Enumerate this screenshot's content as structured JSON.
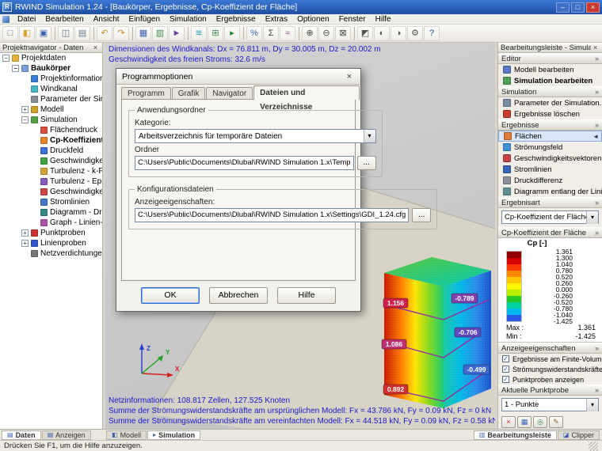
{
  "titlebar": {
    "title": "RWIND Simulation 1.24 - [Baukörper, Ergebnisse, Cp-Koeffizient der Fläche]",
    "minimize": "–",
    "maximize": "□",
    "close": "×"
  },
  "menubar": {
    "items": [
      "Datei",
      "Bearbeiten",
      "Ansicht",
      "Einfügen",
      "Simulation",
      "Ergebnisse",
      "Extras",
      "Optionen",
      "Fenster",
      "Hilfe"
    ]
  },
  "toolbar": {
    "icons": [
      {
        "name": "new-project",
        "glyph": "□",
        "color": "#5a6b7d"
      },
      {
        "name": "open-project",
        "glyph": "◧",
        "color": "#d9a43a"
      },
      {
        "name": "save-project",
        "glyph": "▣",
        "color": "#3a62b0"
      },
      {
        "name": "print",
        "glyph": "◫",
        "color": "#5a6b7d"
      },
      {
        "name": "copy-view",
        "glyph": "▤",
        "color": "#6a7b8d"
      },
      {
        "name": "undo",
        "glyph": "↶",
        "color": "#c09020"
      },
      {
        "name": "redo",
        "glyph": "↷",
        "color": "#c09020"
      },
      {
        "name": "table-view",
        "glyph": "▦",
        "color": "#3a62b0"
      },
      {
        "name": "grid-view",
        "glyph": "▥",
        "color": "#3a8a50"
      },
      {
        "name": "animation",
        "glyph": "►",
        "color": "#7040a0"
      },
      {
        "name": "wind-flow",
        "glyph": "≋",
        "color": "#2a9ab0"
      },
      {
        "name": "mesh",
        "glyph": "⊞",
        "color": "#3a8a50"
      },
      {
        "name": "start-simulation",
        "glyph": "▸",
        "color": "#208030"
      },
      {
        "name": "percent-scale",
        "glyph": "%",
        "color": "#3a62b0"
      },
      {
        "name": "sum-forces",
        "glyph": "Σ",
        "color": "#444444"
      },
      {
        "name": "chart-view",
        "glyph": "≈",
        "color": "#884488"
      },
      {
        "name": "zoom-in",
        "glyph": "⊕",
        "color": "#444444"
      },
      {
        "name": "zoom-out",
        "glyph": "⊖",
        "color": "#444444"
      },
      {
        "name": "zoom-window",
        "glyph": "⊠",
        "color": "#444444"
      },
      {
        "name": "view-iso",
        "glyph": "◩",
        "color": "#555555"
      },
      {
        "name": "view-x",
        "glyph": "◐",
        "color": "#555555"
      },
      {
        "name": "view-z",
        "glyph": "◑",
        "color": "#555555"
      },
      {
        "name": "settings",
        "glyph": "⚙",
        "color": "#555555"
      },
      {
        "name": "help",
        "glyph": "?",
        "color": "#205090"
      }
    ]
  },
  "navigator": {
    "title": "Projektnavigator - Daten",
    "close_icon": "×",
    "tree": [
      {
        "label": "Projektdaten",
        "exp": "−",
        "color": "#e8b33a"
      },
      {
        "label": "Baukörper",
        "exp": "−",
        "color": "#7aa0d8"
      },
      {
        "label": "Projektinformationen",
        "exp": "",
        "color": "#3a7bd5"
      },
      {
        "label": "Windkanal",
        "exp": "",
        "color": "#49b6c4"
      },
      {
        "label": "Parameter der Simulation",
        "exp": "",
        "color": "#8a8f98"
      },
      {
        "label": "Modell",
        "exp": "+",
        "color": "#c9a227"
      },
      {
        "label": "Simulation",
        "exp": "−",
        "color": "#56a347"
      },
      {
        "label": "Flächendruck",
        "exp": "",
        "color": "#d94f3d"
      },
      {
        "label": "Cp-Koeffizient der Fl",
        "exp": "",
        "color": "#e8842a"
      },
      {
        "label": "Druckfeld",
        "exp": "",
        "color": "#3f6fd8"
      },
      {
        "label": "Geschwindigkeitsfeld",
        "exp": "",
        "color": "#44a344"
      },
      {
        "label": "Turbulenz - k-Feld",
        "exp": "",
        "color": "#d1a43a"
      },
      {
        "label": "Turbulenz - Epsilon-Feld",
        "exp": "",
        "color": "#8a5bbf"
      },
      {
        "label": "Geschwindigkeitsvektoren",
        "exp": "",
        "color": "#cc4444"
      },
      {
        "label": "Stromlinien",
        "exp": "",
        "color": "#4477cc"
      },
      {
        "label": "Diagramm - Druckdifferenz",
        "exp": "",
        "color": "#338888"
      },
      {
        "label": "Graph - Linien-Proben",
        "exp": "",
        "color": "#aa55aa"
      },
      {
        "label": "Punktproben",
        "exp": "+",
        "color": "#cc3333"
      },
      {
        "label": "Linienproben",
        "exp": "+",
        "color": "#3355cc"
      },
      {
        "label": "Netzverdichtungen",
        "exp": "",
        "color": "#777777"
      }
    ]
  },
  "viewport": {
    "info_top": [
      "Dimensionen des Windkanals: Dx = 76.811 m, Dy = 30.005 m, Dz = 20.002 m",
      "Geschwindigkeit des freien Stroms: 32.6 m/s"
    ],
    "info_bottom": [
      "Netzinformationen: 108.817 Zellen, 127.525 Knoten",
      "Summe der Strömungswiderstandskräfte am ursprünglichen Modell: Fx = 43.786 kN, Fy = 0.09 kN, Fz = 0 kN",
      "Summe der Strömungswiderstandskräfte am vereinfachten Modell: Fx = 44.518 kN, Fy = 0.09 kN, Fz = 0.58 kN"
    ],
    "probes": [
      {
        "value": "1.156",
        "color": "#d02048"
      },
      {
        "value": "-0.789",
        "color": "#8040b0"
      },
      {
        "value": "1.086",
        "color": "#c03070"
      },
      {
        "value": "-0.706",
        "color": "#6048c0"
      },
      {
        "value": "0.892",
        "color": "#d03030"
      },
      {
        "value": "-0.499",
        "color": "#4068d0"
      }
    ],
    "axes": {
      "x": "X",
      "y": "Y",
      "z": "Z"
    }
  },
  "dialog": {
    "title": "Programmoptionen",
    "close_icon": "×",
    "dropdown_arrow": "▾",
    "tabs": [
      "Programm",
      "Grafik",
      "Navigator",
      "Dateien und Verzeichnisse"
    ],
    "group1": {
      "legend": "Anwendungsordner",
      "kategorie_label": "Kategorie:",
      "kategorie_value": "Arbeitsverzeichnis für temporäre Dateien",
      "ordner_label": "Ordner",
      "ordner_value": "C:\\Users\\Public\\Documents\\Dlubal\\RWIND Simulation 1.x\\Temp",
      "browse": "..."
    },
    "group2": {
      "legend": "Konfigurationsdateien",
      "anzeige_label": "Anzeigeeigenschaften:",
      "anzeige_value": "C:\\Users\\Public\\Documents\\Dlubal\\RWIND Simulation 1.x\\Settings\\GDI_1.24.cfg",
      "browse": "..."
    },
    "buttons": {
      "ok": "OK",
      "cancel": "Abbrechen",
      "help": "Hilfe"
    }
  },
  "editbar": {
    "title": "Bearbeitungsleiste - Simulation",
    "close_icon": "×",
    "section_arrow": "»",
    "editor": {
      "header": "Editor",
      "items": [
        {
          "label": "Modell bearbeiten",
          "color": "#5b79c4"
        },
        {
          "label": "Simulation bearbeiten",
          "color": "#4e9e58"
        }
      ]
    },
    "simulation": {
      "header": "Simulation",
      "items": [
        {
          "label": "Parameter der Simulation...",
          "color": "#7d8da0"
        },
        {
          "label": "Ergebnisse löschen",
          "color": "#cc3b2f"
        }
      ]
    },
    "results": {
      "header": "Ergebnisse",
      "selected_marker": "◄",
      "items": [
        {
          "label": "Flächen",
          "color": "#e07a36"
        },
        {
          "label": "Strömungsfeld",
          "color": "#3f8fd2"
        },
        {
          "label": "Geschwindigkeitsvektoren",
          "color": "#c44747"
        },
        {
          "label": "Stromlinien",
          "color": "#3a66b8"
        },
        {
          "label": "Druckdifferenz",
          "color": "#8a8f98"
        },
        {
          "label": "Diagramm entlang der Linie",
          "color": "#5b8f8f"
        }
      ]
    },
    "result_type": {
      "header": "Ergebnisart",
      "value": "Cp-Koeffizient der Fläche",
      "arrow": "▾"
    },
    "scale": {
      "header": "Cp-Koeffizient der Fläche",
      "unit": "Cp [-]",
      "values": [
        "1.361",
        "1.300",
        "1.040",
        "0.780",
        "0.520",
        "0.260",
        "0.000",
        "-0.260",
        "-0.520",
        "-0.780",
        "-1.040",
        "-1.425"
      ],
      "colors": [
        "#900000",
        "#d40000",
        "#ff3800",
        "#ff8800",
        "#ffc800",
        "#fff600",
        "#b8f000",
        "#28c828",
        "#00d0a0",
        "#00b8f0",
        "#2858e8"
      ],
      "max_label": "Max :",
      "max_value": "1.361",
      "min_label": "Min :",
      "min_value": "-1.425"
    },
    "display": {
      "header": "Anzeigeeigenschaften",
      "check_glyph": "✓",
      "checks": [
        {
          "label": "Ergebnisse am Finite-Volume..."
        },
        {
          "label": "Strömungswiderstandskräfte an..."
        },
        {
          "label": "Punktproben anzeigen"
        }
      ]
    },
    "probe": {
      "header": "Aktuelle Punktprobe",
      "value": "1 - Punkte",
      "arrow": "▾",
      "buttons": [
        {
          "name": "delete-point-probe",
          "glyph": "×",
          "color": "#cc2222"
        },
        {
          "name": "point-probe-table",
          "glyph": "▦",
          "color": "#3a62b0"
        },
        {
          "name": "point-probe-pick",
          "glyph": "◎",
          "color": "#3a8a50"
        },
        {
          "name": "point-probe-edit",
          "glyph": "✎",
          "color": "#8a6d2a"
        }
      ]
    }
  },
  "bottombar": {
    "left_tabs": [
      {
        "label": "Daten",
        "glyph": "▤"
      },
      {
        "label": "Anzeigen",
        "glyph": "▤"
      }
    ],
    "center_tabs": [
      {
        "label": "Modell",
        "glyph": "◧"
      },
      {
        "label": "Simulation",
        "glyph": "▸"
      }
    ],
    "right_buttons": [
      {
        "label": "Bearbeitungsleiste",
        "glyph": "▥"
      },
      {
        "label": "Clipper",
        "glyph": "◪"
      }
    ]
  },
  "statusbar": {
    "text": "Drücken Sie F1, um die Hilfe anzuzeigen."
  }
}
